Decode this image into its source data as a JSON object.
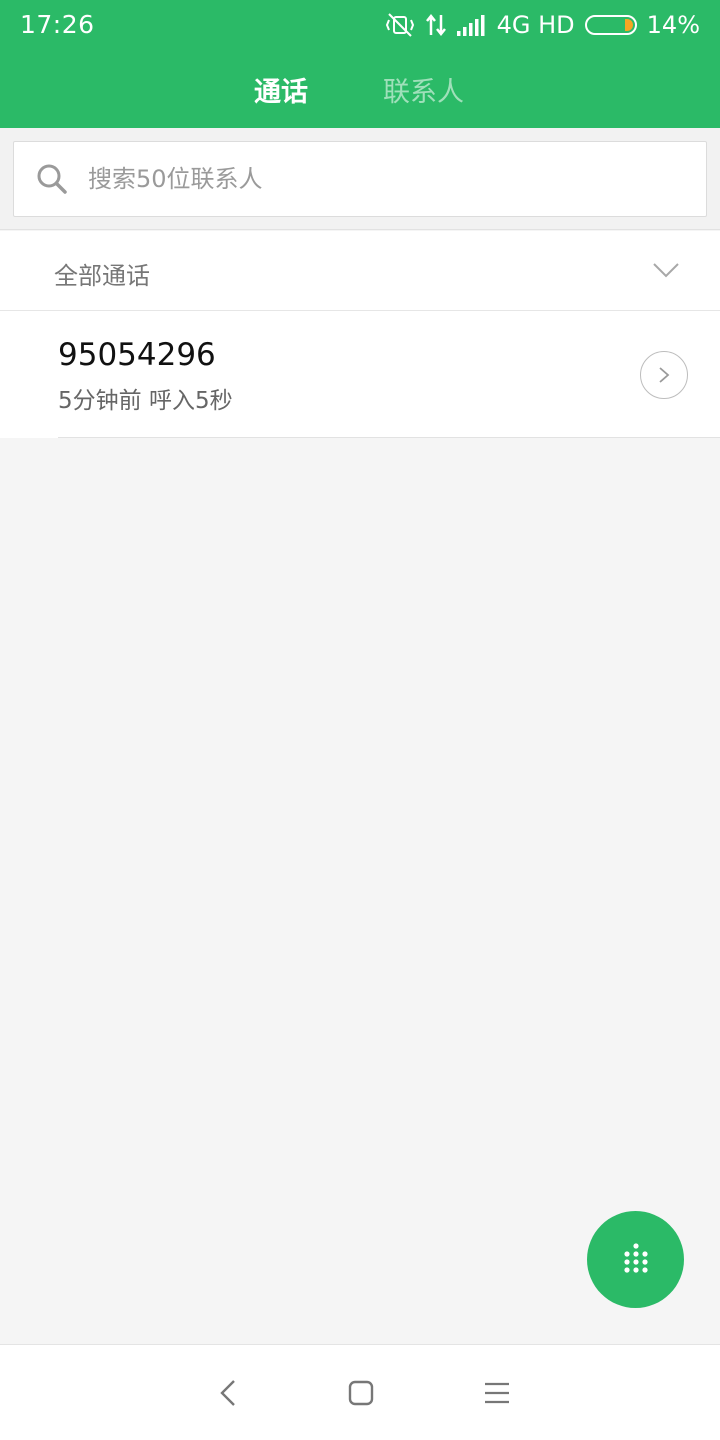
{
  "status_bar": {
    "time": "17:26",
    "network": "4G HD",
    "battery": "14%",
    "battery_level": 0.14,
    "icons": [
      "vibrate-off-icon",
      "data-transfer-icon",
      "signal-icon",
      "battery-icon"
    ]
  },
  "tabs": [
    {
      "label": "通话",
      "active": true
    },
    {
      "label": "联系人",
      "active": false
    }
  ],
  "search": {
    "placeholder": "搜索50位联系人",
    "value": ""
  },
  "filter": {
    "label": "全部通话"
  },
  "call_log": [
    {
      "number": "95054296",
      "meta": "5分钟前 呼入5秒"
    }
  ],
  "colors": {
    "accent": "#2bba67",
    "battery_fill": "#f6a623"
  },
  "nav": [
    "back",
    "home",
    "menu"
  ]
}
